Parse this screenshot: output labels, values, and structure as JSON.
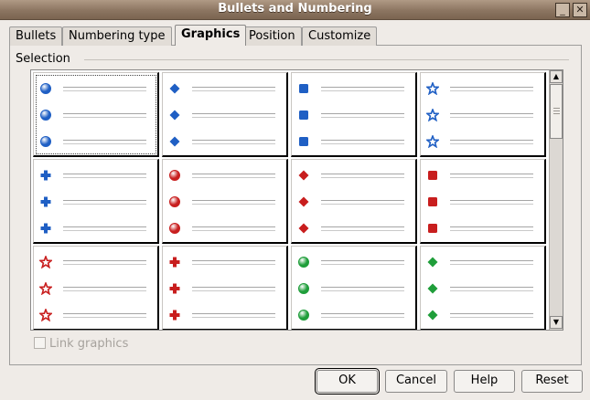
{
  "window": {
    "title": "Bullets and Numbering",
    "minimize_glyph": "_",
    "close_glyph": "✕"
  },
  "tabs": [
    {
      "label": "Bullets",
      "active": false
    },
    {
      "label": "Numbering type",
      "active": false
    },
    {
      "label": "Graphics",
      "active": true
    },
    {
      "label": "Position",
      "active": false
    },
    {
      "label": "Customize",
      "active": false
    }
  ],
  "selection": {
    "label": "Selection",
    "selected_index": 0,
    "cells": [
      {
        "bullet": "sphere",
        "color": "#1f5fc4"
      },
      {
        "bullet": "diamond",
        "color": "#1f5fc4"
      },
      {
        "bullet": "square",
        "color": "#1f5fc4"
      },
      {
        "bullet": "star",
        "color": "#1f5fc4"
      },
      {
        "bullet": "plus",
        "color": "#1f5fc4"
      },
      {
        "bullet": "sphere",
        "color": "#c81e1e"
      },
      {
        "bullet": "diamond",
        "color": "#c81e1e"
      },
      {
        "bullet": "square",
        "color": "#c81e1e"
      },
      {
        "bullet": "star",
        "color": "#c81e1e"
      },
      {
        "bullet": "plus",
        "color": "#c81e1e"
      },
      {
        "bullet": "sphere",
        "color": "#1f9e3a"
      },
      {
        "bullet": "diamond",
        "color": "#1f9e3a"
      }
    ],
    "scroll_up_glyph": "▲",
    "scroll_down_glyph": "▼"
  },
  "link_graphics": {
    "label": "Link graphics",
    "checked": false,
    "enabled": false
  },
  "buttons": {
    "ok": "OK",
    "cancel": "Cancel",
    "help": "Help",
    "reset": "Reset"
  }
}
